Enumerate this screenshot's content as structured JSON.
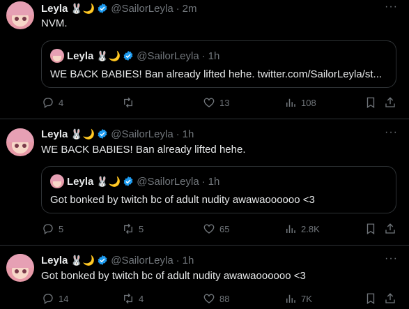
{
  "author": {
    "name": "Leyla",
    "emoji": "🐰🌙",
    "handle": "@SailorLeyla",
    "sep": "·"
  },
  "tweets": [
    {
      "time": "2m",
      "text": "NVM.",
      "quote": {
        "time": "1h",
        "text": "WE BACK BABIES! Ban already lifted hehe. twitter.com/SailorLeyla/st..."
      },
      "stats": {
        "replies": "4",
        "retweets": "",
        "likes": "13",
        "views": "108"
      }
    },
    {
      "time": "1h",
      "text": "WE BACK BABIES! Ban already lifted hehe.",
      "quote": {
        "time": "1h",
        "text": "Got bonked by twitch bc of adult nudity awawaoooooo <3"
      },
      "stats": {
        "replies": "5",
        "retweets": "5",
        "likes": "65",
        "views": "2.8K"
      }
    },
    {
      "time": "1h",
      "text": "Got bonked by twitch bc of adult nudity awawaoooooo <3",
      "stats": {
        "replies": "14",
        "retweets": "4",
        "likes": "88",
        "views": "7K"
      }
    }
  ],
  "icons": {
    "reply": "reply-icon",
    "retweet": "retweet-icon",
    "like": "heart-icon",
    "views": "views-icon",
    "bookmark": "bookmark-icon",
    "share": "share-icon",
    "more": "more-icon"
  },
  "colors": {
    "background": "#000000",
    "text": "#e7e9ea",
    "muted": "#71767b",
    "verified": "#1d9bf0",
    "border": "#2f3336"
  }
}
